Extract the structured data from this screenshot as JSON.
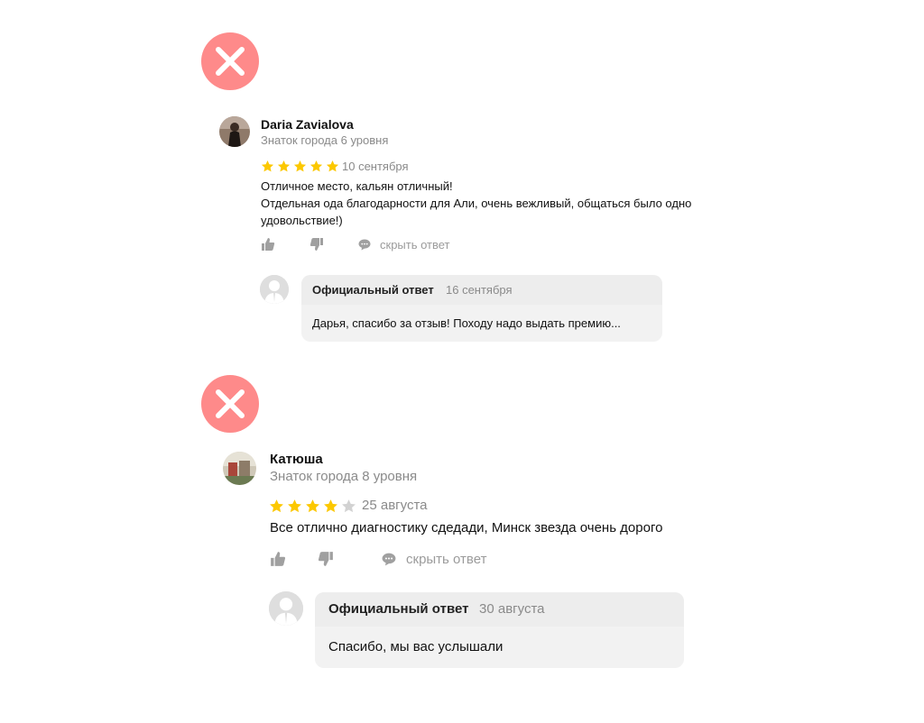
{
  "colors": {
    "reject": "#fe8a8a",
    "star_filled": "#fcc800",
    "star_empty": "#d2d2d2",
    "muted_text": "#8a8a8a",
    "bubble_bg": "#f2f2f2"
  },
  "reviews": [
    {
      "author": "Daria Zavialova",
      "level": "Знаток города 6 уровня",
      "rating": 5,
      "date": "10 сентября",
      "text_lines": [
        "Отличное место, кальян отличный!",
        "Отдельная ода благодарности для Али, очень вежливый, общаться было одно",
        "удовольствие!)"
      ],
      "hide_label": "скрыть ответ",
      "reply": {
        "title": "Официальный ответ",
        "date": "16 сентября",
        "text": "Дарья, спасибо за отзыв! Походу надо выдать премию..."
      }
    },
    {
      "author": "Катюша",
      "level": "Знаток города 8 уровня",
      "rating": 4,
      "date": "25 августа",
      "text_lines": [
        "Все отлично диагностику сдедади, Минск звезда очень дорого"
      ],
      "hide_label": "скрыть ответ",
      "reply": {
        "title": "Официальный ответ",
        "date": "30 августа",
        "text": "Спасибо, мы вас услышали"
      }
    }
  ]
}
